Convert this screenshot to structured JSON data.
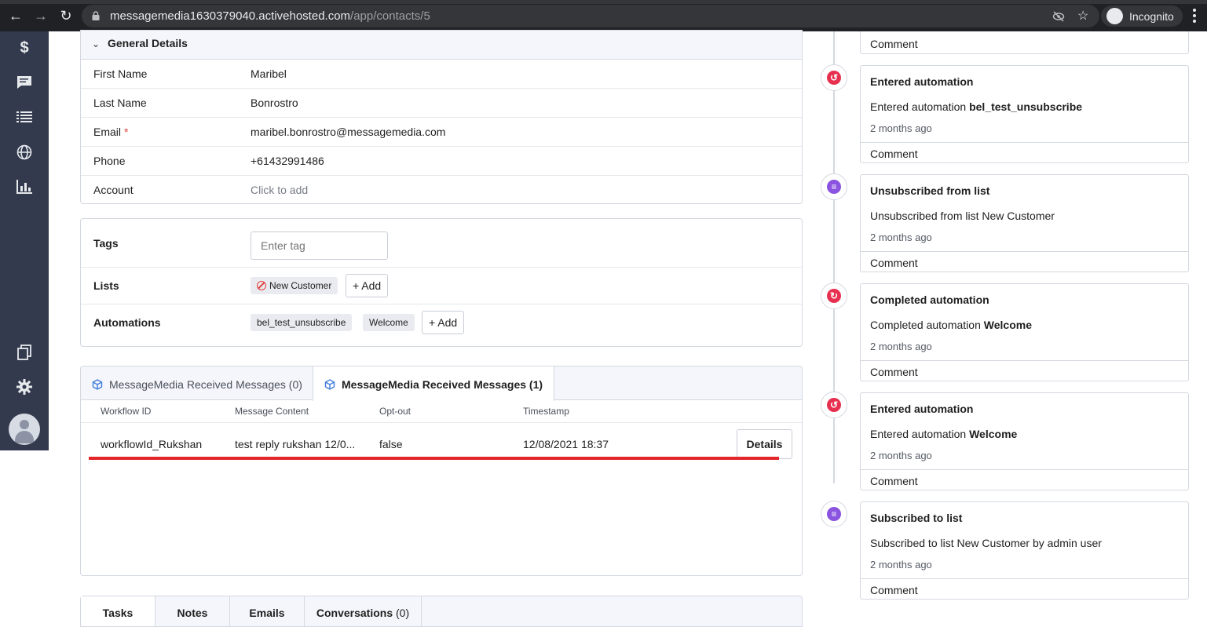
{
  "browser": {
    "url_host": "messagemedia1630379040.activehosted.com",
    "url_path": "/app/contacts/5",
    "profile_label": "Incognito"
  },
  "sidebar": {
    "items": [
      {
        "name": "deals",
        "icon": "dollar-icon"
      },
      {
        "name": "conversations",
        "icon": "chat-icon"
      },
      {
        "name": "lists",
        "icon": "list-icon"
      },
      {
        "name": "website",
        "icon": "globe-icon"
      },
      {
        "name": "reports",
        "icon": "bar-chart-icon"
      },
      {
        "name": "pages",
        "icon": "copy-icon"
      },
      {
        "name": "settings",
        "icon": "gear-icon"
      }
    ]
  },
  "general_details": {
    "title": "General Details",
    "fields": [
      {
        "label": "First Name",
        "value": "Maribel",
        "required": false
      },
      {
        "label": "Last Name",
        "value": "Bonrostro",
        "required": false
      },
      {
        "label": "Email",
        "value": "maribel.bonrostro@messagemedia.com",
        "required": true
      },
      {
        "label": "Phone",
        "value": "+61432991486",
        "required": false
      },
      {
        "label": "Account",
        "value": "Click to add",
        "required": false
      }
    ],
    "required_mark": "*"
  },
  "tags": {
    "tags_label": "Tags",
    "tag_placeholder": "Enter tag",
    "lists_label": "Lists",
    "lists": [
      "New Customer"
    ],
    "automations_label": "Automations",
    "automations": [
      "bel_test_unsubscribe",
      "Welcome"
    ],
    "add_label": "+ Add"
  },
  "messages": {
    "tabs": [
      {
        "label": "MessageMedia Received Messages (0)"
      },
      {
        "label": "MessageMedia Received Messages (1)"
      }
    ],
    "columns": [
      "Workflow ID",
      "Message Content",
      "Opt-out",
      "Timestamp"
    ],
    "rows": [
      {
        "workflow_id": "workflowId_Rukshan",
        "content": "test reply rukshan 12/0...",
        "opt_out": "false",
        "timestamp": "12/08/2021 18:37"
      }
    ],
    "details_label": "Details"
  },
  "bottom_tabs": [
    {
      "label": "Tasks",
      "count": ""
    },
    {
      "label": "Notes",
      "count": ""
    },
    {
      "label": "Emails",
      "count": ""
    },
    {
      "label": "Conversations",
      "count": "(0)"
    }
  ],
  "timeline": {
    "comment_label": "Comment",
    "items": [
      {
        "title": "Entered automation",
        "desc_prefix": "Entered automation ",
        "desc_bold": "bel_test_unsubscribe",
        "desc_suffix": "",
        "time": "2 months ago",
        "icon": "automation-entered-icon",
        "color": "#e7304f"
      },
      {
        "title": "Unsubscribed from list",
        "desc_prefix": "Unsubscribed from list New Customer",
        "desc_bold": "",
        "desc_suffix": "",
        "time": "2 months ago",
        "icon": "list-icon",
        "color": "#8a53e0"
      },
      {
        "title": "Completed automation",
        "desc_prefix": "Completed automation ",
        "desc_bold": "Welcome",
        "desc_suffix": "",
        "time": "2 months ago",
        "icon": "automation-completed-icon",
        "color": "#e7304f"
      },
      {
        "title": "Entered automation",
        "desc_prefix": "Entered automation ",
        "desc_bold": "Welcome",
        "desc_suffix": "",
        "time": "2 months ago",
        "icon": "automation-entered-icon",
        "color": "#e7304f"
      },
      {
        "title": "Subscribed to list",
        "desc_prefix": "Subscribed to list New Customer by admin user",
        "desc_bold": "",
        "desc_suffix": "",
        "time": "2 months ago",
        "icon": "list-icon",
        "color": "#8a53e0"
      }
    ]
  }
}
